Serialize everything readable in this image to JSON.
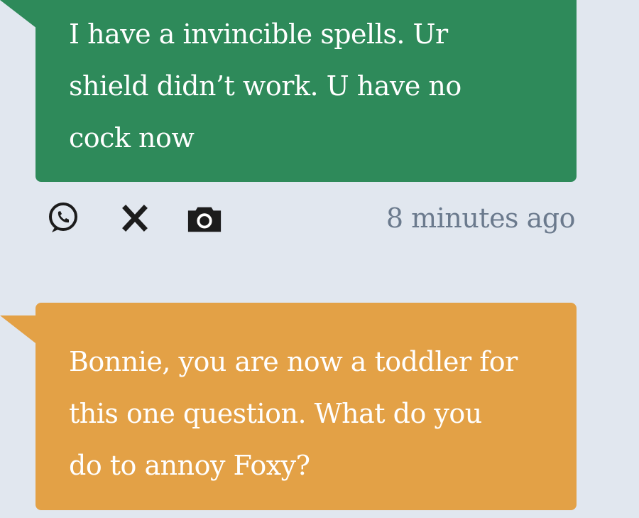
{
  "messages": [
    {
      "lines": [
        "I have a invincible spells. Ur",
        "shield didn’t work. U have no",
        "cock now"
      ],
      "color": "#2e8a5a",
      "actions": [
        "whatsapp-icon",
        "x-icon",
        "camera-icon"
      ],
      "timestamp": "8 minutes ago"
    },
    {
      "lines": [
        "Bonnie, you are now a toddler for",
        "this one question. What do you",
        "do to annoy Foxy?"
      ],
      "color": "#e3a146"
    }
  ],
  "colors": {
    "background": "#e1e7ef",
    "timestamp": "#6b7a8d",
    "icon": "#1c1c1c"
  }
}
